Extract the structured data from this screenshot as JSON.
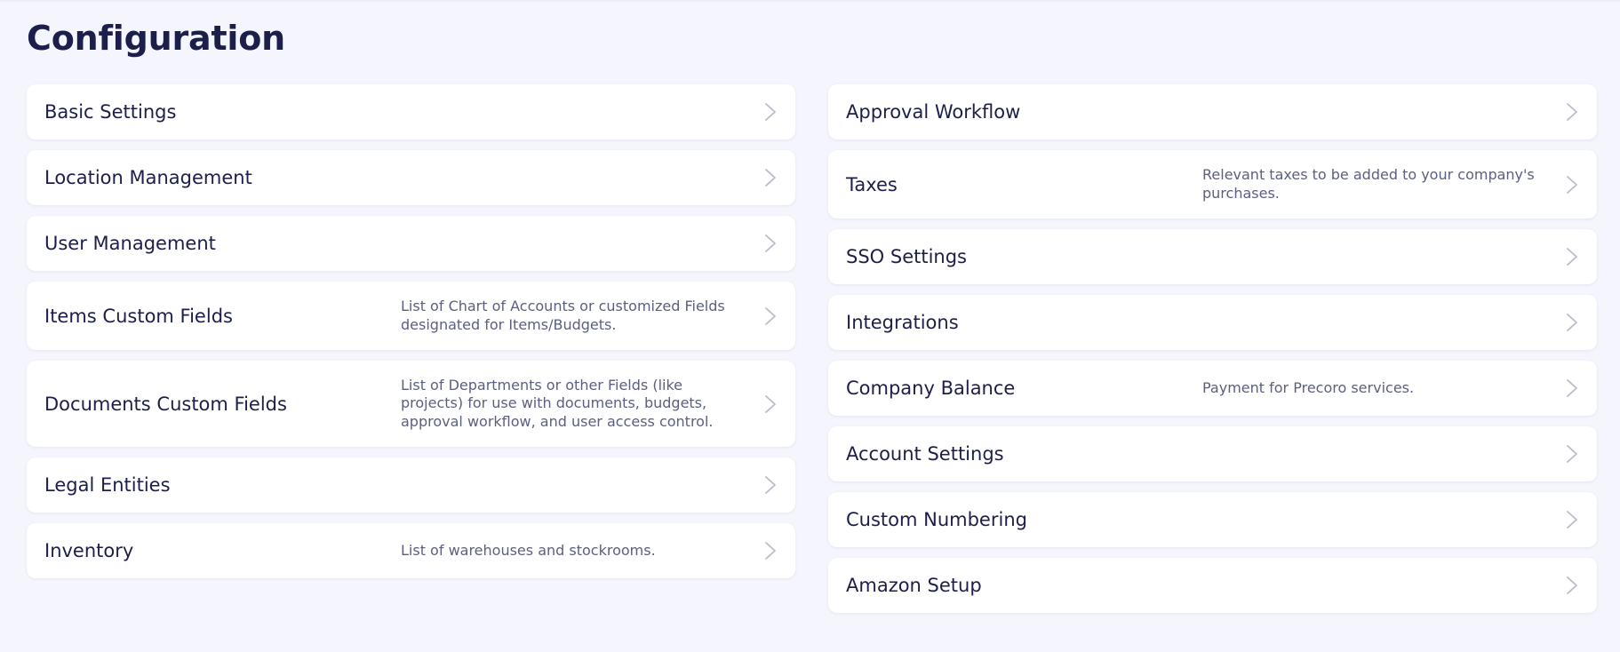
{
  "page": {
    "title": "Configuration"
  },
  "colors": {
    "background": "#f4f5fd",
    "card": "#ffffff",
    "text": "#1c1f4a",
    "description": "#5b6082",
    "chevron": "#b9bccc"
  },
  "icons": {
    "chevron": "chevron-right-icon"
  },
  "left_column": [
    {
      "label": "Basic Settings",
      "description": ""
    },
    {
      "label": "Location Management",
      "description": ""
    },
    {
      "label": "User Management",
      "description": ""
    },
    {
      "label": "Items Custom Fields",
      "description": "List of Chart of Accounts or customized Fields designated for Items/Budgets."
    },
    {
      "label": "Documents Custom Fields",
      "description": "List of Departments or other Fields (like projects) for use with documents, budgets, approval workflow, and user access control."
    },
    {
      "label": "Legal Entities",
      "description": ""
    },
    {
      "label": "Inventory",
      "description": "List of warehouses and stockrooms."
    }
  ],
  "right_column": [
    {
      "label": "Approval Workflow",
      "description": ""
    },
    {
      "label": "Taxes",
      "description": "Relevant taxes to be added to your company's purchases."
    },
    {
      "label": "SSO Settings",
      "description": ""
    },
    {
      "label": "Integrations",
      "description": ""
    },
    {
      "label": "Company Balance",
      "description": "Payment for Precoro services."
    },
    {
      "label": "Account Settings",
      "description": ""
    },
    {
      "label": "Custom Numbering",
      "description": ""
    },
    {
      "label": "Amazon Setup",
      "description": ""
    }
  ]
}
